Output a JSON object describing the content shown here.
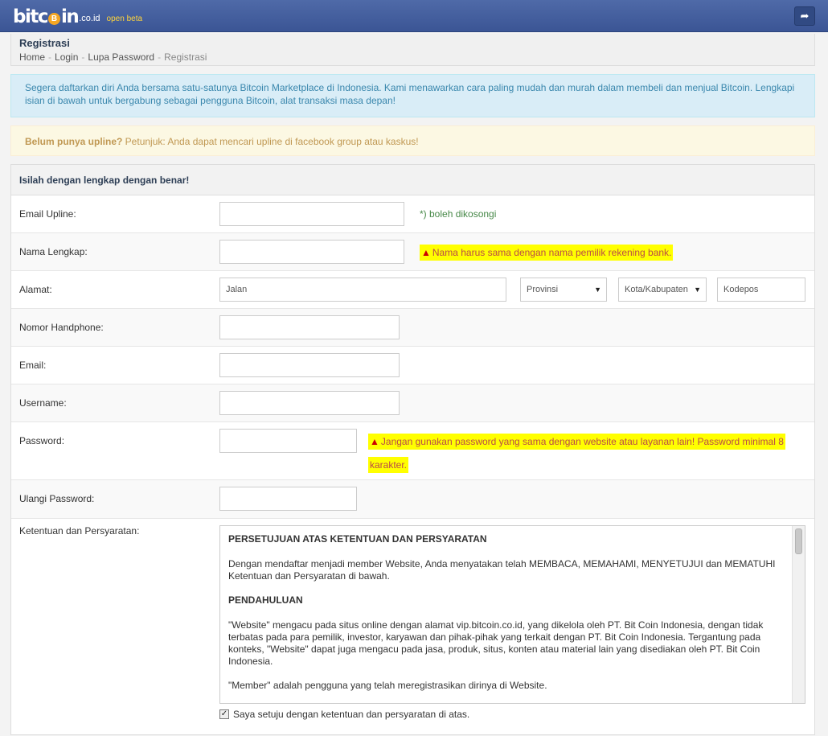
{
  "topbar": {
    "logo_text_a": "bitc",
    "logo_coin": "B",
    "logo_text_b": "in",
    "logo_domain": ".co.id",
    "logo_beta": "open beta",
    "icon": "share-arrow-icon"
  },
  "page": {
    "title": "Registrasi",
    "breadcrumb": [
      "Home",
      "Login",
      "Lupa Password",
      "Registrasi"
    ]
  },
  "alerts": {
    "info": "Segera daftarkan diri Anda bersama satu-satunya Bitcoin Marketplace di Indonesia. Kami menawarkan cara paling mudah dan murah dalam membeli dan menjual Bitcoin. Lengkapi isian di bawah untuk bergabung sebagai pengguna Bitcoin, alat transaksi masa depan!",
    "warn_strong": "Belum punya upline?",
    "warn_text": " Petunjuk: Anda dapat mencari upline di facebook group atau kaskus!"
  },
  "form": {
    "heading": "Isilah dengan lengkap dengan benar!",
    "email_upline": {
      "label": "Email Upline:",
      "value": "",
      "hint": "*) boleh dikosongi"
    },
    "nama": {
      "label": "Nama Lengkap:",
      "value": "",
      "warning": "Nama harus sama dengan nama pemilik rekening bank."
    },
    "alamat": {
      "label": "Alamat:",
      "jalan_placeholder": "Jalan",
      "provinsi": "Provinsi",
      "kota": "Kota/Kabupaten",
      "kodepos_placeholder": "Kodepos"
    },
    "hp": {
      "label": "Nomor Handphone:",
      "value": ""
    },
    "email": {
      "label": "Email:",
      "value": ""
    },
    "username": {
      "label": "Username:",
      "value": ""
    },
    "password": {
      "label": "Password:",
      "value": "",
      "warning_line1": "Jangan gunakan password yang sama dengan website atau layanan lain! Password minimal 8",
      "warning_line2": "karakter."
    },
    "ulangi": {
      "label": "Ulangi Password:",
      "value": ""
    },
    "terms": {
      "label": "Ketentuan dan Persyaratan:",
      "h1": "PERSETUJUAN ATAS KETENTUAN DAN PERSYARATAN",
      "p1": "Dengan mendaftar menjadi member Website, Anda menyatakan telah MEMBACA, MEMAHAMI, MENYETUJUI dan MEMATUHI Ketentuan dan Persyaratan di bawah.",
      "h2": "PENDAHULUAN",
      "p2": "\"Website\" mengacu pada situs online dengan alamat vip.bitcoin.co.id, yang dikelola oleh PT. Bit Coin Indonesia, dengan tidak terbatas pada para pemilik, investor, karyawan dan pihak-pihak yang terkait dengan PT. Bit Coin Indonesia. Tergantung pada konteks, \"Website\" dapat juga mengacu pada jasa, produk, situs, konten atau material lain yang disediakan oleh PT. Bit Coin Indonesia.",
      "p3": "\"Member\" adalah pengguna yang telah meregistrasikan dirinya di Website.",
      "agree": "Saya setuju dengan ketentuan dan persyaratan di atas.",
      "agree_checked": true
    }
  },
  "colors": {
    "topbar": "#3b5595",
    "info_bg": "#d9edf7",
    "warn_bg": "#fcf8e3",
    "highlight": "#ffff00"
  }
}
